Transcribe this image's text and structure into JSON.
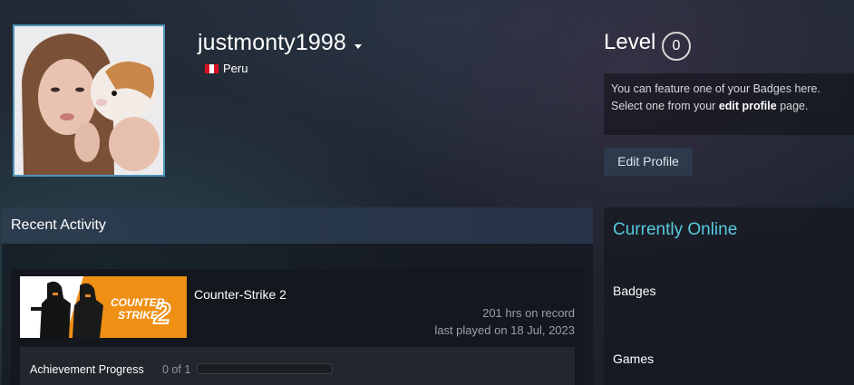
{
  "profile": {
    "username": "justmonty1998",
    "country": "Peru",
    "flag_colors": [
      "#d91023",
      "#ffffff",
      "#d91023"
    ]
  },
  "level": {
    "label": "Level",
    "value": "0",
    "badge_text_before": "You can feature one of your Badges here.",
    "badge_text_line2_before": "Select one from your ",
    "badge_text_link": "edit profile",
    "badge_text_after": " page.",
    "edit_button": "Edit Profile"
  },
  "recent_activity": {
    "title": "Recent Activity",
    "game": {
      "name": "Counter-Strike 2",
      "capsule_line1": "COUNTER",
      "capsule_line2": "STRIKE",
      "capsule_numeral": "2",
      "capsule_color": "#ef8f14",
      "hours": "201 hrs on record",
      "last_played": "last played on 18 Jul, 2023",
      "achievement_label": "Achievement Progress",
      "achievement_count": "0 of 1",
      "achievement_fraction": 0
    }
  },
  "sidebar": {
    "status": "Currently Online",
    "links": [
      "Badges",
      "Games"
    ]
  },
  "colors": {
    "accent_online": "#57cbde",
    "avatar_border": "#4f95b8",
    "button_bg": "#2c3a4c"
  }
}
